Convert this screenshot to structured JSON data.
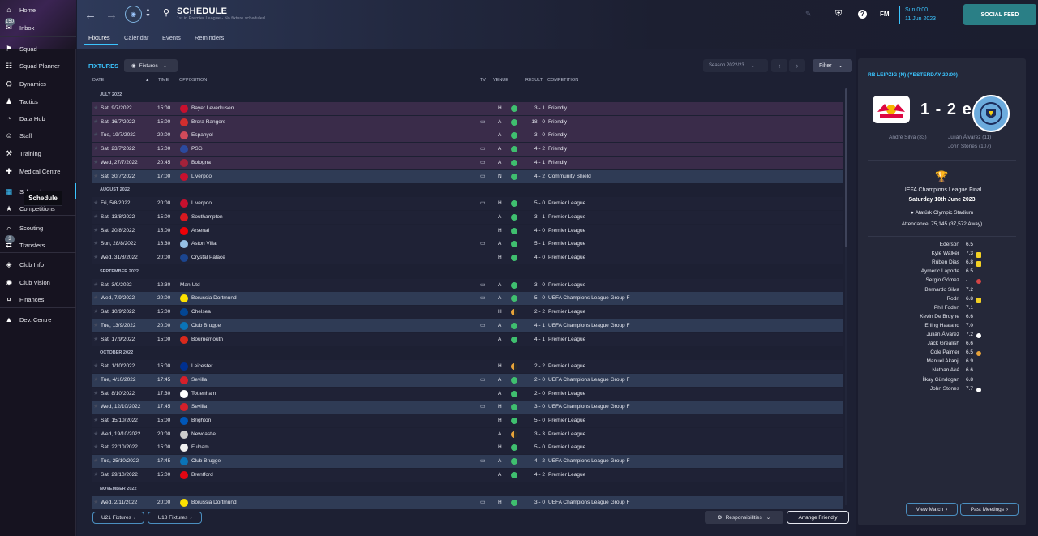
{
  "sidebar": {
    "items": [
      {
        "label": "Home",
        "icon": "home-icon"
      },
      {
        "label": "Inbox",
        "icon": "inbox-icon",
        "badge": "150"
      },
      {
        "label": "Squad",
        "icon": "squad-icon"
      },
      {
        "label": "Squad Planner",
        "icon": "squad-planner-icon"
      },
      {
        "label": "Dynamics",
        "icon": "dynamics-icon"
      },
      {
        "label": "Tactics",
        "icon": "tactics-icon"
      },
      {
        "label": "Data Hub",
        "icon": "data-hub-icon"
      },
      {
        "label": "Staff",
        "icon": "staff-icon"
      },
      {
        "label": "Training",
        "icon": "training-icon"
      },
      {
        "label": "Medical Centre",
        "icon": "medical-icon"
      },
      {
        "label": "Schedule",
        "icon": "calendar-icon",
        "active": true
      },
      {
        "label": "Competitions",
        "icon": "competitions-icon"
      },
      {
        "label": "Scouting",
        "icon": "scouting-icon"
      },
      {
        "label": "Transfers",
        "icon": "transfers-icon",
        "badge": "3"
      },
      {
        "label": "Club Info",
        "icon": "club-info-icon"
      },
      {
        "label": "Club Vision",
        "icon": "club-vision-icon"
      },
      {
        "label": "Finances",
        "icon": "finances-icon"
      },
      {
        "label": "Dev. Centre",
        "icon": "dev-centre-icon"
      }
    ],
    "tooltip": "Schedule"
  },
  "header": {
    "title": "SCHEDULE",
    "subtitle": "1st in Premier League - No fixture scheduled.",
    "tabs": [
      "Fixtures",
      "Calendar",
      "Events",
      "Reminders"
    ],
    "date_time": "Sun 0:00",
    "date_day": "11 Jun 2023",
    "fm_label": "FM",
    "social_feed": "SOCIAL FEED"
  },
  "fixtures": {
    "title": "FIXTURES",
    "dropdown": "Fixtures",
    "season": "Season 2022/23",
    "filter": "Filter",
    "columns": {
      "date": "DATE",
      "time": "TIME",
      "opposition": "OPPOSITION",
      "tv": "TV",
      "venue": "VENUE",
      "result": "RESULT",
      "competition": "COMPETITION"
    },
    "rows": [
      {
        "month": "JULY 2022"
      },
      {
        "date": "Sat, 9/7/2022",
        "time": "15:00",
        "opp": "Bayer Leverkusen",
        "tv": false,
        "venue": "H",
        "result": "3 - 1",
        "outcome": "win",
        "comp": "Friendly",
        "style": "purple",
        "crest": "#c8102e"
      },
      {
        "date": "Sat, 16/7/2022",
        "time": "15:00",
        "opp": "Brora Rangers",
        "tv": true,
        "venue": "A",
        "result": "18 - 0",
        "outcome": "win",
        "comp": "Friendly",
        "style": "purple",
        "crest": "#d22e2e"
      },
      {
        "date": "Tue, 19/7/2022",
        "time": "20:00",
        "opp": "Espanyol",
        "tv": false,
        "venue": "A",
        "result": "3 - 0",
        "outcome": "win",
        "comp": "Friendly",
        "style": "purple",
        "crest": "#d04a5a"
      },
      {
        "date": "Sat, 23/7/2022",
        "time": "15:00",
        "opp": "PSG",
        "tv": true,
        "venue": "A",
        "result": "4 - 2",
        "outcome": "win",
        "comp": "Friendly",
        "style": "purple",
        "crest": "#2b4a9e"
      },
      {
        "date": "Wed, 27/7/2022",
        "time": "20:45",
        "opp": "Bologna",
        "tv": true,
        "venue": "A",
        "result": "4 - 1",
        "outcome": "win",
        "comp": "Friendly",
        "style": "purple",
        "crest": "#a3223a"
      },
      {
        "date": "Sat, 30/7/2022",
        "time": "17:00",
        "opp": "Liverpool",
        "tv": true,
        "venue": "N",
        "result": "4 - 2",
        "outcome": "win",
        "comp": "Community Shield",
        "style": "blue",
        "crest": "#c8102e"
      },
      {
        "month": "AUGUST 2022"
      },
      {
        "date": "Fri, 5/8/2022",
        "time": "20:00",
        "opp": "Liverpool",
        "tv": true,
        "venue": "H",
        "result": "5 - 0",
        "outcome": "win",
        "comp": "Premier League",
        "style": "plain",
        "crest": "#c8102e"
      },
      {
        "date": "Sat, 13/8/2022",
        "time": "15:00",
        "opp": "Southampton",
        "tv": false,
        "venue": "A",
        "result": "3 - 1",
        "outcome": "win",
        "comp": "Premier League",
        "style": "plain",
        "crest": "#d71920"
      },
      {
        "date": "Sat, 20/8/2022",
        "time": "15:00",
        "opp": "Arsenal",
        "tv": false,
        "venue": "H",
        "result": "4 - 0",
        "outcome": "win",
        "comp": "Premier League",
        "style": "plain",
        "crest": "#ef0107"
      },
      {
        "date": "Sun, 28/8/2022",
        "time": "16:30",
        "opp": "Aston Villa",
        "tv": true,
        "venue": "A",
        "result": "5 - 1",
        "outcome": "win",
        "comp": "Premier League",
        "style": "plain",
        "crest": "#95bfe5"
      },
      {
        "date": "Wed, 31/8/2022",
        "time": "20:00",
        "opp": "Crystal Palace",
        "tv": false,
        "venue": "H",
        "result": "4 - 0",
        "outcome": "win",
        "comp": "Premier League",
        "style": "plain",
        "crest": "#1b458f"
      },
      {
        "month": "SEPTEMBER 2022"
      },
      {
        "date": "Sat, 3/9/2022",
        "time": "12:30",
        "opp": "Man Utd",
        "tv": true,
        "venue": "A",
        "result": "3 - 0",
        "outcome": "win",
        "comp": "Premier League",
        "style": "plain",
        "crest": ""
      },
      {
        "date": "Wed, 7/9/2022",
        "time": "20:00",
        "opp": "Borussia Dortmund",
        "tv": true,
        "venue": "A",
        "result": "5 - 0",
        "outcome": "win",
        "comp": "UEFA Champions League Group F",
        "style": "blue",
        "crest": "#fde100"
      },
      {
        "date": "Sat, 10/9/2022",
        "time": "15:00",
        "opp": "Chelsea",
        "tv": false,
        "venue": "H",
        "result": "2 - 2",
        "outcome": "draw",
        "comp": "Premier League",
        "style": "plain",
        "crest": "#034694"
      },
      {
        "date": "Tue, 13/9/2022",
        "time": "20:00",
        "opp": "Club Brugge",
        "tv": true,
        "venue": "A",
        "result": "4 - 1",
        "outcome": "win",
        "comp": "UEFA Champions League Group F",
        "style": "blue",
        "crest": "#0a74b8"
      },
      {
        "date": "Sat, 17/9/2022",
        "time": "15:00",
        "opp": "Bournemouth",
        "tv": false,
        "venue": "A",
        "result": "4 - 1",
        "outcome": "win",
        "comp": "Premier League",
        "style": "plain",
        "crest": "#da291c"
      },
      {
        "month": "OCTOBER 2022"
      },
      {
        "date": "Sat, 1/10/2022",
        "time": "15:00",
        "opp": "Leicester",
        "tv": false,
        "venue": "H",
        "result": "2 - 2",
        "outcome": "draw",
        "comp": "Premier League",
        "style": "plain",
        "crest": "#003090"
      },
      {
        "date": "Tue, 4/10/2022",
        "time": "17:45",
        "opp": "Sevilla",
        "tv": true,
        "venue": "A",
        "result": "2 - 0",
        "outcome": "win",
        "comp": "UEFA Champions League Group F",
        "style": "blue",
        "crest": "#d6202a"
      },
      {
        "date": "Sat, 8/10/2022",
        "time": "17:30",
        "opp": "Tottenham",
        "tv": false,
        "venue": "A",
        "result": "2 - 0",
        "outcome": "win",
        "comp": "Premier League",
        "style": "plain",
        "crest": "#ffffff"
      },
      {
        "date": "Wed, 12/10/2022",
        "time": "17:45",
        "opp": "Sevilla",
        "tv": true,
        "venue": "H",
        "result": "3 - 0",
        "outcome": "win",
        "comp": "UEFA Champions League Group F",
        "style": "blue",
        "crest": "#d6202a"
      },
      {
        "date": "Sat, 15/10/2022",
        "time": "15:00",
        "opp": "Brighton",
        "tv": false,
        "venue": "H",
        "result": "5 - 0",
        "outcome": "win",
        "comp": "Premier League",
        "style": "plain",
        "crest": "#0057b8"
      },
      {
        "date": "Wed, 19/10/2022",
        "time": "20:00",
        "opp": "Newcastle",
        "tv": false,
        "venue": "A",
        "result": "3 - 3",
        "outcome": "draw",
        "comp": "Premier League",
        "style": "plain",
        "crest": "#cccccc"
      },
      {
        "date": "Sat, 22/10/2022",
        "time": "15:00",
        "opp": "Fulham",
        "tv": false,
        "venue": "H",
        "result": "5 - 0",
        "outcome": "win",
        "comp": "Premier League",
        "style": "plain",
        "crest": "#f0f0f0"
      },
      {
        "date": "Tue, 25/10/2022",
        "time": "17:45",
        "opp": "Club Brugge",
        "tv": true,
        "venue": "A",
        "result": "4 - 2",
        "outcome": "win",
        "comp": "UEFA Champions League Group F",
        "style": "blue",
        "crest": "#0a74b8"
      },
      {
        "date": "Sat, 29/10/2022",
        "time": "15:00",
        "opp": "Brentford",
        "tv": false,
        "venue": "A",
        "result": "4 - 2",
        "outcome": "win",
        "comp": "Premier League",
        "style": "plain",
        "crest": "#e30613"
      },
      {
        "month": "NOVEMBER 2022"
      },
      {
        "date": "Wed, 2/11/2022",
        "time": "20:00",
        "opp": "Borussia Dortmund",
        "tv": true,
        "venue": "H",
        "result": "3 - 0",
        "outcome": "win",
        "comp": "UEFA Champions League Group F",
        "style": "blue",
        "crest": "#fde100"
      }
    ],
    "u21": "U21 Fixtures",
    "u18": "U18 Fixtures",
    "responsibilities": "Responsibilities",
    "arrange": "Arrange Friendly"
  },
  "panel": {
    "head": "RB LEIPZIG (N) (YESTERDAY 20:00)",
    "score": "1 - 2 e",
    "home_scorers": [
      "André Silva (83)"
    ],
    "away_scorers": [
      "Julián Álvarez (11)",
      "John Stones (107)"
    ],
    "competition": "UEFA Champions League Final",
    "match_date": "Saturday 10th June 2023",
    "stadium": "Atatürk Olympic Stadium",
    "attendance": "Attendance: 75,145 (37,572 Away)",
    "players": [
      {
        "name": "Ederson",
        "rating": "6.5",
        "icon": ""
      },
      {
        "name": "Kyle Walker",
        "rating": "7.3",
        "icon": "yellow-card"
      },
      {
        "name": "Rúben Dias",
        "rating": "6.8",
        "icon": "yellow-card"
      },
      {
        "name": "Aymeric Laporte",
        "rating": "6.5",
        "icon": ""
      },
      {
        "name": "Sergio Gómez",
        "rating": "-",
        "icon": "sub-off"
      },
      {
        "name": "Bernardo Silva",
        "rating": "7.2",
        "icon": ""
      },
      {
        "name": "Rodri",
        "rating": "6.8",
        "icon": "yellow-card"
      },
      {
        "name": "Phil Foden",
        "rating": "7.1",
        "icon": ""
      },
      {
        "name": "Kevin De Bruyne",
        "rating": "6.6",
        "icon": ""
      },
      {
        "name": "Erling Haaland",
        "rating": "7.0",
        "icon": ""
      },
      {
        "name": "Julián Álvarez",
        "rating": "7.2",
        "icon": "goal"
      },
      {
        "name": "Jack Grealish",
        "rating": "6.6",
        "icon": ""
      },
      {
        "name": "Cole Palmer",
        "rating": "6.5",
        "icon": "sub-on"
      },
      {
        "name": "Manuel Akanji",
        "rating": "6.9",
        "icon": ""
      },
      {
        "name": "Nathan Aké",
        "rating": "6.6",
        "icon": ""
      },
      {
        "name": "İlkay Gündogan",
        "rating": "6.8",
        "icon": ""
      },
      {
        "name": "John Stones",
        "rating": "7.7",
        "icon": "goal"
      }
    ],
    "view_match": "View Match",
    "past_meetings": "Past Meetings"
  },
  "colors": {
    "accent": "#3bc5ff",
    "win": "#3fbf6f",
    "draw": "#e8a33a",
    "purple_row": "#3a2c4a",
    "blue_row": "#2f3b55",
    "plain_row": "#1f2236"
  }
}
